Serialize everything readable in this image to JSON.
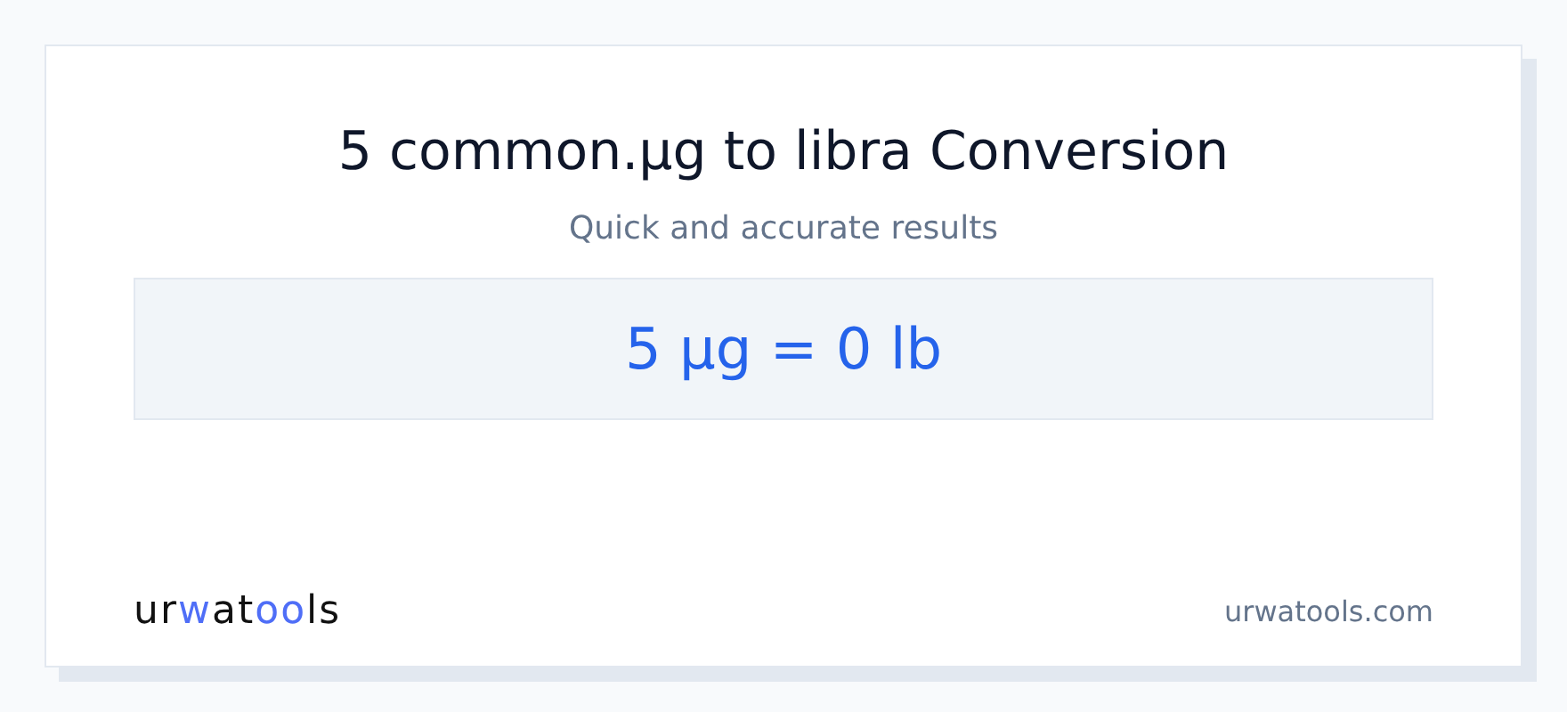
{
  "title": "5 common.µg to libra Conversion",
  "subtitle": "Quick and accurate results",
  "result": "5 µg = 0 lb",
  "logo": [
    {
      "text": "ur",
      "accent": false
    },
    {
      "text": "w",
      "accent": true
    },
    {
      "text": "at",
      "accent": false
    },
    {
      "text": "oo",
      "accent": true
    },
    {
      "text": "ls",
      "accent": false
    }
  ],
  "site": "urwatools.com"
}
